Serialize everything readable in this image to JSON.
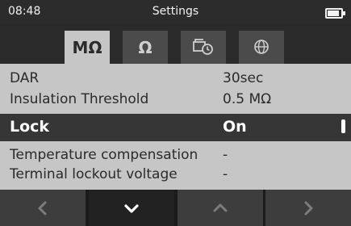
{
  "status_bar": {
    "time": "08:48",
    "title": "Settings",
    "battery_level": 0.85
  },
  "tabs": [
    {
      "label": "MΩ",
      "icon": "megaohm-text",
      "active": true
    },
    {
      "label": "Ω",
      "icon": "ohm-text",
      "active": false
    },
    {
      "label": "",
      "icon": "clock-timer-icon",
      "active": false
    },
    {
      "label": "",
      "icon": "globe-icon",
      "active": false
    }
  ],
  "settings": [
    {
      "label": "DAR",
      "value": "30sec"
    },
    {
      "label": "Insulation Threshold",
      "value": "0.5 MΩ"
    },
    {
      "label": "Lock",
      "value": "On",
      "selected": true
    },
    {
      "label": "Temperature compensation",
      "value": "-"
    },
    {
      "label": "Terminal lockout voltage",
      "value": "-"
    }
  ],
  "nav_buttons": [
    {
      "icon": "chevron-left-icon",
      "pressed": false
    },
    {
      "icon": "chevron-down-icon",
      "pressed": true
    },
    {
      "icon": "chevron-up-icon",
      "pressed": false
    },
    {
      "icon": "chevron-right-icon",
      "pressed": false
    }
  ],
  "colors": {
    "panel": "#c6c6c6",
    "selected_row": "#363636",
    "status_bar": "#2c2c2c",
    "tab_inactive": "#4b4b4b",
    "nav_button": "#3d3d3d",
    "nav_button_pressed": "#222222"
  }
}
